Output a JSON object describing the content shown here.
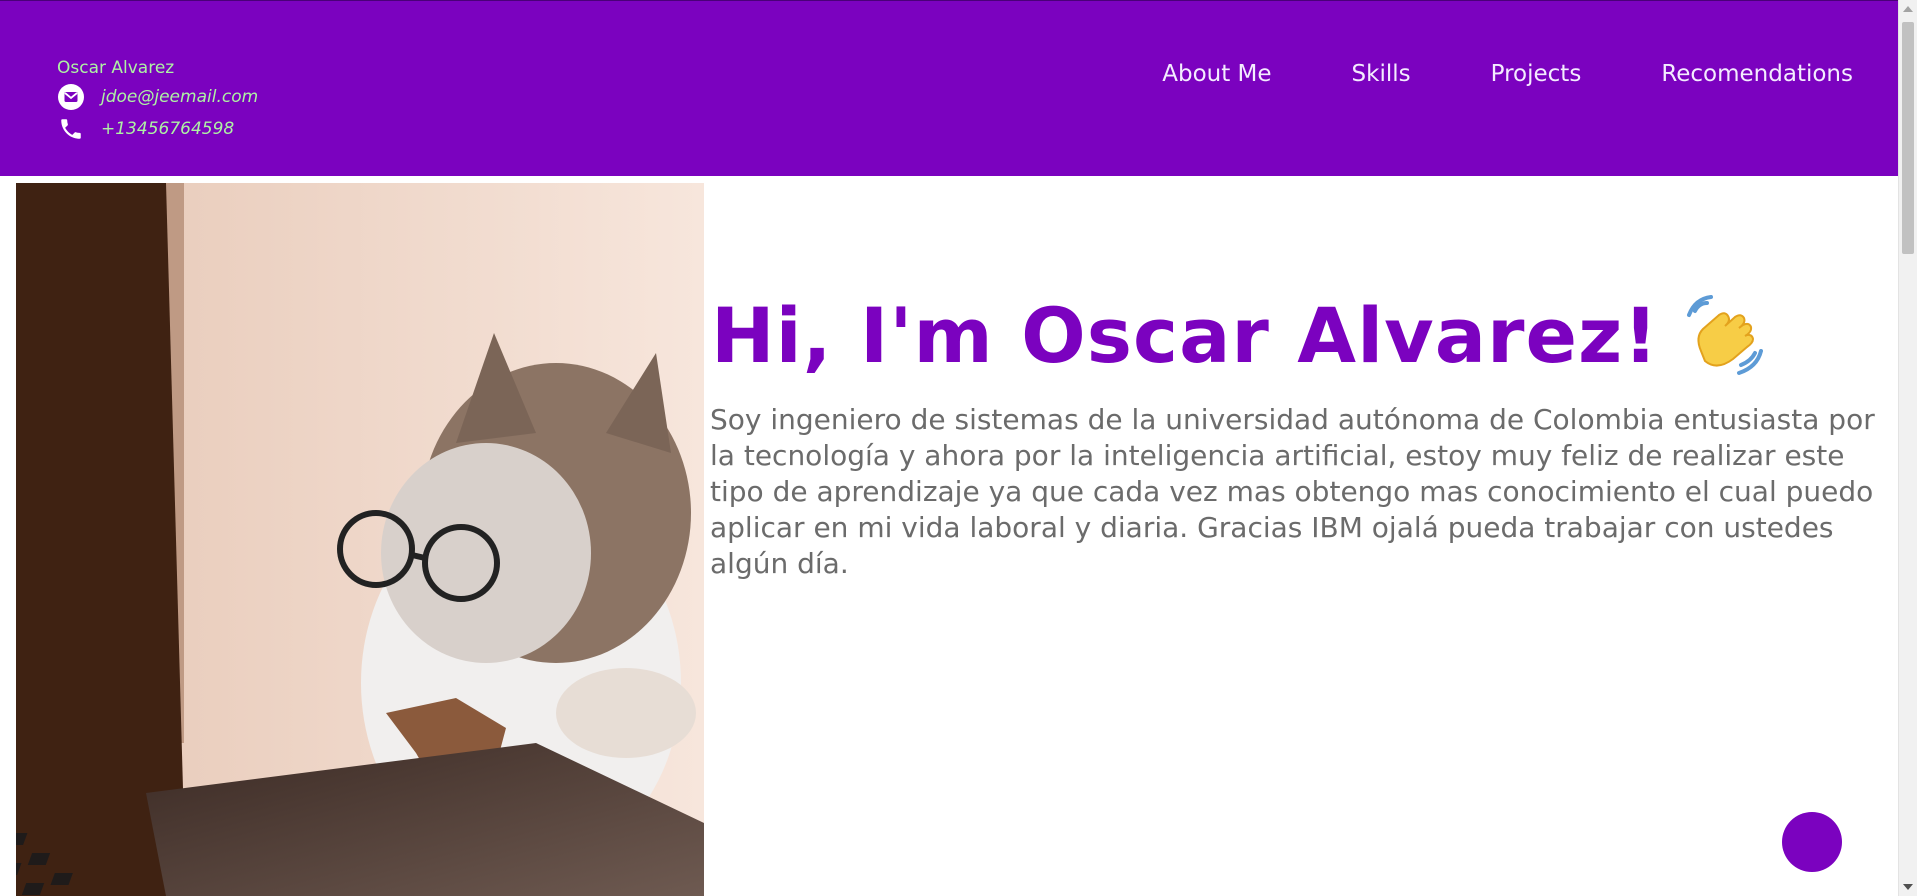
{
  "header": {
    "name": "Oscar Alvarez",
    "email": "jdoe@jeemail.com",
    "phone": "+13456764598",
    "nav": [
      "About Me",
      "Skills",
      "Projects",
      "Recomendations"
    ]
  },
  "main": {
    "title": "Hi, I'm Oscar Alvarez!",
    "bio": "Soy ingeniero de sistemas de la universidad autónoma de Colombia entusiasta por la tecnología y ahora por la inteligencia artificial, estoy muy feliz de realizar este tipo de aprendizaje ya que cada vez mas obtengo mas conocimiento el cual puedo aplicar en mi vida laboral y diaria. Gracias IBM ojalá pueda trabajar con ustedes algún día."
  },
  "icons": {
    "email": "envelope-icon",
    "phone": "phone-icon",
    "wave": "waving-hand-icon"
  },
  "colors": {
    "brand": "#7b02bf",
    "contact_text": "#aef2a4",
    "body_text": "#6b6b6b"
  }
}
